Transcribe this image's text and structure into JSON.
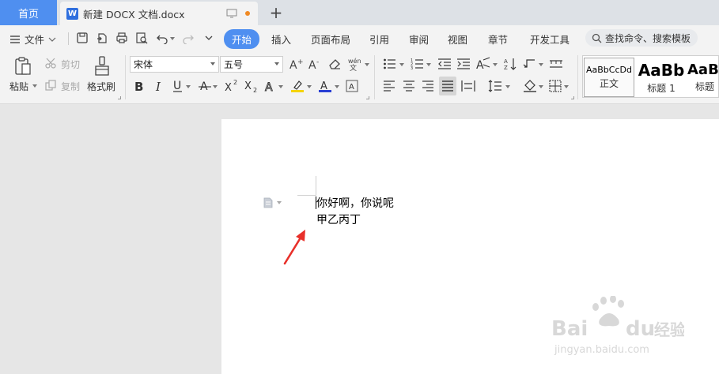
{
  "colors": {
    "accent": "#4f8ff0",
    "tab_bar_bg": "#dde1e6",
    "ribbon_bg": "#f3f3f3",
    "doc_bg": "#e6e6e6",
    "unsaved_dot": "#f08a24",
    "annotation_arrow": "#e8302a",
    "highlight_yellow": "#f5d400",
    "font_color_blue": "#2a3fd4"
  },
  "tabs": {
    "home": "首页",
    "document": "新建 DOCX 文档.docx",
    "new_tab": "+"
  },
  "menu": {
    "file": "文件",
    "tabs": [
      "开始",
      "插入",
      "页面布局",
      "引用",
      "审阅",
      "视图",
      "章节",
      "开发工具"
    ],
    "active_tab": "开始",
    "search_placeholder": "查找命令、搜索模板"
  },
  "ribbon": {
    "paste": "粘贴",
    "cut": "剪切",
    "copy": "复制",
    "format_painter": "格式刷",
    "font_name": "宋体",
    "font_size": "五号",
    "styles": [
      {
        "preview": "AaBbCcDd",
        "name": "正文"
      },
      {
        "preview": "AaBb",
        "name": "标题 1"
      },
      {
        "preview": "AaB",
        "name": "标题"
      }
    ]
  },
  "document": {
    "lines": [
      "你好啊，你说呢",
      "甲乙丙丁"
    ]
  },
  "watermark": {
    "brand": "Bai",
    "brand_suffix": "du",
    "product": "经验",
    "url": "jingyan.baidu.com"
  },
  "icons": {
    "menu": "hamburger-icon",
    "save": "save-icon",
    "print": "print-icon",
    "undo": "undo-icon",
    "redo": "redo-icon",
    "search": "search-icon",
    "paragraph_handle": "document-icon"
  }
}
